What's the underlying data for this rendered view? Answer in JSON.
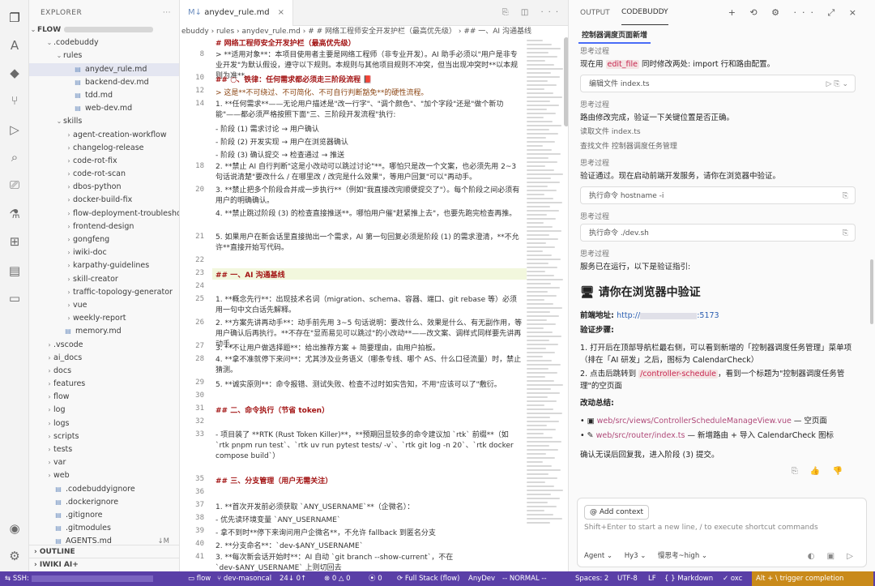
{
  "explorer": {
    "title": "EXPLORER",
    "root": "FLOW",
    "items": [
      {
        "label": ".codebuddy",
        "type": "folder-open"
      },
      {
        "label": "rules",
        "type": "folder-open"
      },
      {
        "label": "anydev_rule.md",
        "type": "file"
      },
      {
        "label": "backend-dev.md",
        "type": "file"
      },
      {
        "label": "tdd.md",
        "type": "file"
      },
      {
        "label": "web-dev.md",
        "type": "file"
      },
      {
        "label": "skills",
        "type": "folder-open"
      },
      {
        "label": "agent-creation-workflow",
        "type": "folder"
      },
      {
        "label": "changelog-release",
        "type": "folder"
      },
      {
        "label": "code-rot-fix",
        "type": "folder"
      },
      {
        "label": "code-rot-scan",
        "type": "folder"
      },
      {
        "label": "dbos-python",
        "type": "folder"
      },
      {
        "label": "docker-build-fix",
        "type": "folder"
      },
      {
        "label": "flow-deployment-troubleshoot",
        "type": "folder"
      },
      {
        "label": "frontend-design",
        "type": "folder"
      },
      {
        "label": "gongfeng",
        "type": "folder"
      },
      {
        "label": "iwiki-doc",
        "type": "folder"
      },
      {
        "label": "karpathy-guidelines",
        "type": "folder"
      },
      {
        "label": "skill-creator",
        "type": "folder"
      },
      {
        "label": "traffic-topology-generator",
        "type": "folder"
      },
      {
        "label": "vue",
        "type": "folder"
      },
      {
        "label": "weekly-report",
        "type": "folder"
      },
      {
        "label": "memory.md",
        "type": "file"
      },
      {
        "label": ".vscode",
        "type": "folder"
      },
      {
        "label": "ai_docs",
        "type": "folder"
      },
      {
        "label": "docs",
        "type": "folder"
      },
      {
        "label": "features",
        "type": "folder"
      },
      {
        "label": "flow",
        "type": "folder"
      },
      {
        "label": "log",
        "type": "folder"
      },
      {
        "label": "logs",
        "type": "folder"
      },
      {
        "label": "scripts",
        "type": "folder"
      },
      {
        "label": "tests",
        "type": "folder"
      },
      {
        "label": "var",
        "type": "folder"
      },
      {
        "label": "web",
        "type": "folder"
      },
      {
        "label": ".codebuddyignore",
        "type": "file"
      },
      {
        "label": ".dockerignore",
        "type": "file"
      },
      {
        "label": ".gitignore",
        "type": "file"
      },
      {
        "label": ".gitmodules",
        "type": "file"
      },
      {
        "label": "AGENTS.md",
        "type": "file",
        "badge": "↓M"
      }
    ],
    "outline": "OUTLINE",
    "iwiki": "IWIKI AI+"
  },
  "editor": {
    "tab": "anydev_rule.md",
    "breadcrumb": "ebuddy › rules › anydev_rule.md › # # 网络工程师安全开发护栏（最高优先级） › ## 一、AI 沟通基线",
    "lines": [
      {
        "n": "",
        "t": "# 网络工程师安全开发护栏（最高优先级）",
        "k": "hd"
      },
      {
        "n": "8",
        "t": "> **适用对象**：本项目使用者主要是网络工程师（非专业开发）。AI 助手必须以\"用户是非专业开发\"为默认假设，遵守以下规则。本规则与其他项目规则不冲突，但当出现冲突时**以本规则为准**。",
        "k": "wrap"
      },
      {
        "n": "10",
        "t": "## ○、铁律：任何需求都必须走三阶段流程 📕",
        "k": "hd"
      },
      {
        "n": "12",
        "t": "> 这是**不可绕过、不可简化、不可自行判断豁免**的硬性流程。",
        "k": "q"
      },
      {
        "n": "14",
        "t": "1. **任何需求**——无论用户描述是\"改一行字\"、\"调个颜色\"、\"加个字段\"还是\"做个新功能\"——都必须严格按照下面\"三、三阶段开发流程\"执行:",
        "k": "wrap"
      },
      {
        "n": "",
        "t": "   - 阶段 (1) 需求讨论 → 用户确认",
        "k": ""
      },
      {
        "n": "",
        "t": "   - 阶段 (2) 开发实现 → 用户在浏览器确认",
        "k": ""
      },
      {
        "n": "",
        "t": "   - 阶段 (3) 确认提交 → 检查通过 → 推送",
        "k": ""
      },
      {
        "n": "18",
        "t": "2. **禁止 AI 自行判断\"这是小改动可以跳过讨论\"**。哪怕只是改一个文案，也必须先用 2~3 句话说清楚\"要改什么 / 在哪里改 / 改完是什么效果\"，等用户回复\"可以\"再动手。",
        "k": "wrap"
      },
      {
        "n": "20",
        "t": "3. **禁止把多个阶段合并成一步执行**（例如\"我直接改完顺便提交了\"）。每个阶段之间必须有用户的明确确认。",
        "k": "wrap"
      },
      {
        "n": "",
        "t": "4. **禁止跳过阶段 (3) 的检查直接推送**。哪怕用户催\"赶紧推上去\"，也要先跑完检查再推。",
        "k": "wrap"
      },
      {
        "n": "21",
        "t": "5. 如果用户在新会话里直接抛出一个需求，AI 第一句回复必须是阶段 (1) 的需求澄清，**不允许**直接开始写代码。",
        "k": "wrap"
      },
      {
        "n": "22",
        "t": "",
        "k": ""
      },
      {
        "n": "23",
        "t": "## 一、AI 沟通基线",
        "k": "hd"
      },
      {
        "n": "24",
        "t": "",
        "k": ""
      },
      {
        "n": "25",
        "t": "1. **概念先行**：出现技术名词（migration、schema、容器、端口、git rebase 等）必须用一句中文白话先解释。",
        "k": "wrap"
      },
      {
        "n": "26",
        "t": "2. **方案先讲再动手**：动手前先用 3~5 句话说明：要改什么、效果是什么、有无副作用，等用户确认后再执行。**不存在\"显而易见可以跳过\"的小改动**——改文案、调样式同样要先讲再动手。",
        "k": "wrap"
      },
      {
        "n": "27",
        "t": "3. **不让用户做选择题**：给出推荐方案 + 简要理由，由用户拍板。",
        "k": ""
      },
      {
        "n": "28",
        "t": "4. **拿不准就停下来问**：尤其涉及业务语义（哪条专线、哪个 AS、什么口径流量）时，禁止猜测。",
        "k": "wrap"
      },
      {
        "n": "29",
        "t": "5. **诚实原则**：命令报错、测试失败、检查不过时如实告知，不用\"应该可以了\"敷衍。",
        "k": ""
      },
      {
        "n": "30",
        "t": "",
        "k": ""
      },
      {
        "n": "31",
        "t": "## 二、命令执行（节省 token）",
        "k": "hd"
      },
      {
        "n": "32",
        "t": "",
        "k": ""
      },
      {
        "n": "33",
        "t": "- 项目装了 **RTK (Rust Token Killer)**，**预期回显较多的命令建议加 `rtk` 前缀**（如 `rtk pnpm run test`、`rtk uv run pytest tests/ -v`、`rtk git log -n 20`、`rtk docker compose build`）",
        "k": "wrap"
      },
      {
        "n": "35",
        "t": "## 三、分支管理（用户无需关注）",
        "k": "hd"
      },
      {
        "n": "36",
        "t": "",
        "k": ""
      },
      {
        "n": "37",
        "t": "1. **首次开发前必须获取 `ANY_USERNAME`**（企微名）：",
        "k": ""
      },
      {
        "n": "38",
        "t": "   - 优先读环境变量 `ANY_USERNAME`",
        "k": ""
      },
      {
        "n": "39",
        "t": "   - 拿不到时**停下来询问用户企微名**，不允许 fallback 到匿名分支",
        "k": ""
      },
      {
        "n": "40",
        "t": "2. **分支命名**：`dev-$ANY_USERNAME`",
        "k": ""
      },
      {
        "n": "41",
        "t": "3. **每次新会话开始时**：AI 自动 `git branch --show-current`，不在 `dev-$ANY_USERNAME` 上则切回去",
        "k": "wrap"
      }
    ]
  },
  "panel": {
    "tabs": [
      "OUTPUT",
      "CODEBUDDY"
    ],
    "subtab": "控制器调度页面新增",
    "think": "思考过程",
    "msg1_pre": "现在用 ",
    "msg1_code": "edit_file",
    "msg1_post": " 同时修改两处: import 行和路由配置。",
    "tool1": "编辑文件  index.ts",
    "msg2": "路由修改完成，验证一下关键位置是否正确。",
    "read_file": "读取文件  index.ts",
    "find_file": "查找文件  控制器调度任务管理",
    "msg3": "验证通过。现在启动前端开发服务，请你在浏览器中验证。",
    "tool2": "执行命令  hostname -i",
    "tool3": "执行命令  ./dev.sh",
    "msg4": "服务已在运行，以下是验证指引:",
    "h2": "🖥 请你在浏览器中验证",
    "frontend_label": "前端地址: ",
    "frontend_url_a": "http://",
    "frontend_url_b": ":5173",
    "steps_label": "验证步骤:",
    "step1": "1. 打开后在顶部导航栏最右侧，可以看到新增的「控制器调度任务管理」菜单项（排在「AI 研发」之后，图标为 CalendarCheck）",
    "step2_pre": "2. 点击后跳转到 ",
    "step2_code": "/controller-schedule",
    "step2_post": "，看到一个标题为\"控制器调度任务管理\"的空页面",
    "changes_label": "改动总结:",
    "change1_file": "web/src/views/ControllerScheduleManageView.vue",
    "change1_desc": " — 空页面",
    "change2_file": "web/src/router/index.ts",
    "change2_desc": " — 新增路由 + 导入 CalendarCheck 图标",
    "confirm": "确认无误后回复我，进入阶段 (3) 提交。",
    "add_context": "@ Add context",
    "placeholder": "Shift+Enter to start a new line, / to execute shortcut commands",
    "agent": "Agent ⌄",
    "model": "Hy3 ⌄",
    "mode": "慢思考~high ⌄"
  },
  "status": {
    "ssh": "SSH:",
    "branch": "flow",
    "git": "dev-masoncal",
    "sync": "24↓ 0↑",
    "errors": "⊗ 0 △ 0",
    "ports": "0",
    "stack": "Full Stack (flow)",
    "anydev": "AnyDev",
    "mode": "-- NORMAL --",
    "spaces": "Spaces: 2",
    "encoding": "UTF-8",
    "eol": "LF",
    "lang": "Markdown",
    "oxc": "oxc",
    "trigger": "Alt + \\ trigger completion"
  }
}
